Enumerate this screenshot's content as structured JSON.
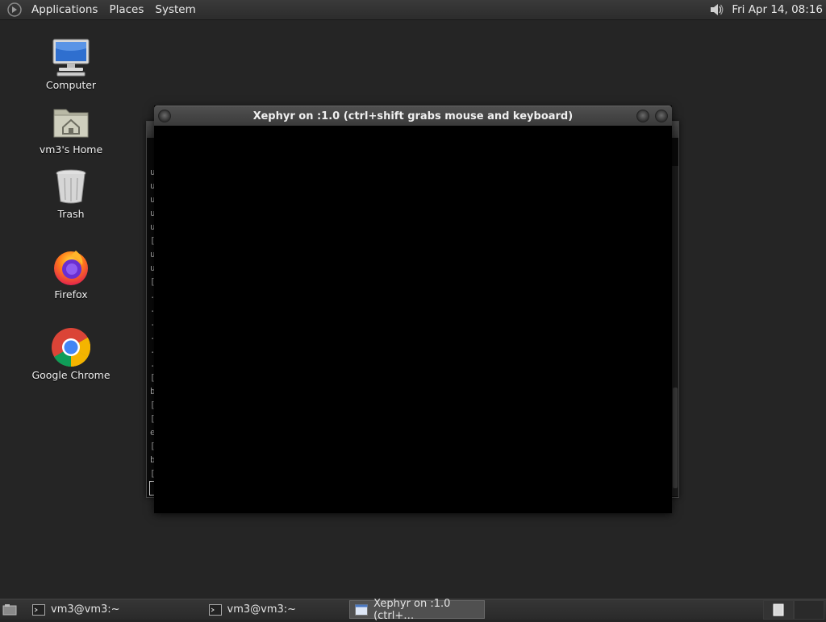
{
  "top_panel": {
    "menus": [
      "Applications",
      "Places",
      "System"
    ],
    "clock": "Fri Apr 14, 08:16",
    "icons": {
      "logo": "gnome-foot-icon",
      "volume": "volume-icon"
    }
  },
  "desktop": {
    "icons": [
      {
        "label": "Computer",
        "icon": "computer-icon"
      },
      {
        "label": "vm3's Home",
        "icon": "home-folder-icon"
      },
      {
        "label": "Trash",
        "icon": "trash-icon"
      },
      {
        "label": "Firefox",
        "icon": "firefox-icon"
      },
      {
        "label": "Google Chrome",
        "icon": "chrome-icon"
      }
    ]
  },
  "terminal_bg": {
    "visible_chars": [
      "u",
      "u",
      "u",
      "u",
      "u",
      "[",
      "u",
      "u",
      "[",
      ".",
      ".",
      ".",
      ".",
      ".",
      ".",
      "[",
      "b",
      "[",
      "[",
      "e",
      "[",
      "b",
      "["
    ]
  },
  "xephyr": {
    "title": "Xephyr on :1.0 (ctrl+shift grabs mouse and keyboard)"
  },
  "taskbar": {
    "tasks": [
      {
        "label": "vm3@vm3:~",
        "icon": "terminal-icon",
        "active": false
      },
      {
        "label": "vm3@vm3:~",
        "icon": "terminal-icon",
        "active": false
      },
      {
        "label": "Xephyr on :1.0 (ctrl+…",
        "icon": "window-icon",
        "active": true
      }
    ],
    "icons": {
      "show_desktop": "show-desktop-icon",
      "workspace": "workspace-switcher-icon"
    }
  },
  "colors": {
    "desktop_bg": "#252525",
    "panel_bg": "#2f2f2f",
    "xephyr_content": "#000000"
  }
}
